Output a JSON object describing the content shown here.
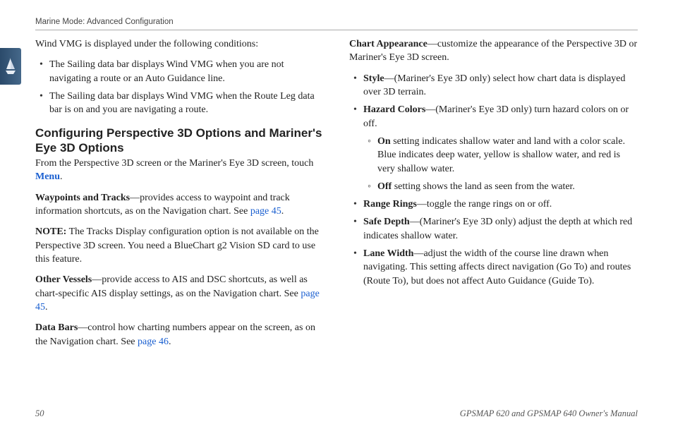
{
  "header": {
    "running_title": "Marine Mode: Advanced Configuration"
  },
  "left": {
    "intro": "Wind VMG is displayed under the following conditions:",
    "conditions": [
      "The Sailing data bar displays Wind VMG when you are not navigating a route or an Auto Guidance line.",
      "The Sailing data bar displays Wind VMG when the Route Leg data bar is on and you are navigating a route."
    ],
    "heading": "Configuring Perspective 3D Options and Mariner's Eye 3D Options",
    "from_text_pre": "From the Perspective 3D screen or the Mariner's Eye 3D screen, touch ",
    "from_menu": "Menu",
    "from_text_post": ".",
    "waypoints_label": "Waypoints and Tracks",
    "waypoints_text": "—provides access to waypoint and track information shortcuts, as on the Navigation chart. See ",
    "waypoints_link": "page 45",
    "waypoints_end": ".",
    "note_label": "NOTE:",
    "note_text": " The Tracks Display configuration option is not available on the Perspective 3D screen. You need a BlueChart g2 Vision SD card to use this feature.",
    "other_label": "Other Vessels",
    "other_text": "—provide access to AIS and DSC shortcuts, as well as chart-specific AIS display settings, as on the Navigation chart. See ",
    "other_link": "page 45",
    "other_end": ".",
    "databars_label": "Data Bars",
    "databars_text": "—control how charting numbers appear on the screen, as on the Navigation chart. See ",
    "databars_link": "page 46",
    "databars_end": "."
  },
  "right": {
    "chart_label": "Chart Appearance",
    "chart_text": "—customize the appearance of the Perspective 3D or Mariner's Eye 3D screen.",
    "items": {
      "style_label": "Style",
      "style_text": "—(Mariner's Eye 3D only) select how chart data is displayed over 3D terrain.",
      "hazard_label": "Hazard Colors",
      "hazard_text": "—(Mariner's Eye 3D only) turn hazard colors on or off.",
      "on_label": "On",
      "on_text": " setting indicates shallow water and land with a color scale. Blue indicates deep water, yellow is shallow water, and red is very shallow water.",
      "off_label": "Off",
      "off_text": " setting shows the land as seen from the water.",
      "range_label": "Range Rings",
      "range_text": "—toggle the range rings on or off.",
      "safe_label": "Safe Depth",
      "safe_text": "—(Mariner's Eye 3D only) adjust the depth at which red indicates shallow water.",
      "lane_label": "Lane Width",
      "lane_text": "—adjust the width of the course line drawn when navigating. This setting affects direct navigation (Go To) and routes (Route To), but does not affect Auto Guidance (Guide To)."
    }
  },
  "footer": {
    "page": "50",
    "manual": "GPSMAP 620 and GPSMAP 640 Owner's Manual"
  }
}
